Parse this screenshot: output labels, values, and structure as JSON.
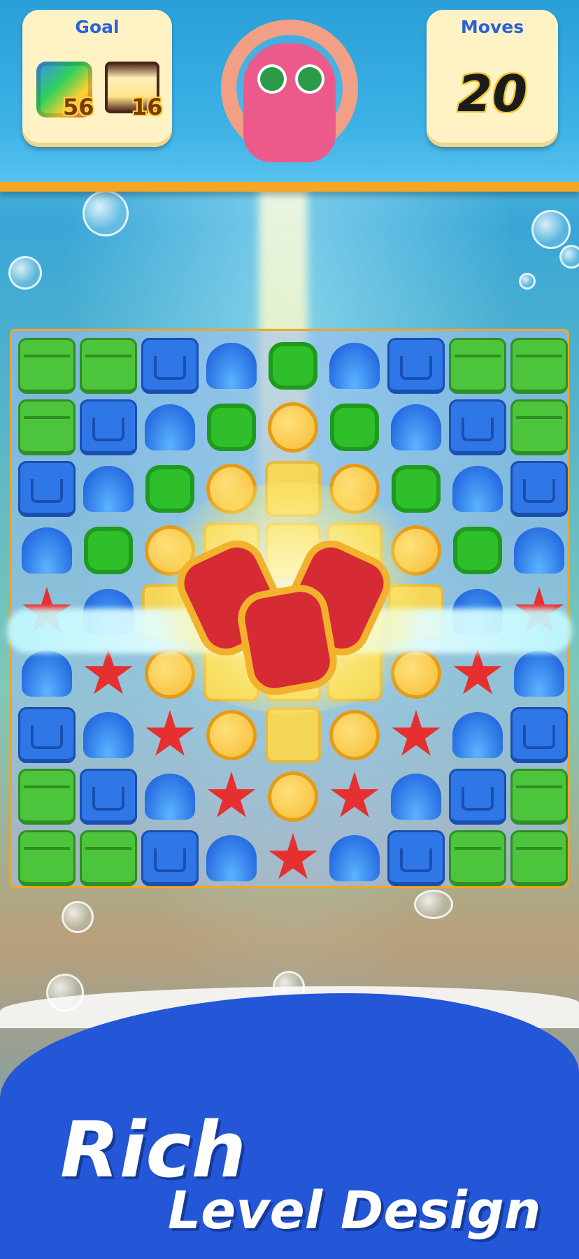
{
  "hud": {
    "goal_title": "Goal",
    "goal_items": [
      {
        "icon": "crown-block-icon",
        "count": "56"
      },
      {
        "icon": "treasure-chest-icon",
        "count": "16"
      }
    ],
    "moves_title": "Moves",
    "moves_value": "20"
  },
  "board": {
    "rows": [
      [
        "crate-g",
        "crate-g",
        "crate-b",
        "shell",
        "turtle",
        "shell",
        "crate-b",
        "crate-g",
        "crate-g"
      ],
      [
        "crate-g",
        "crate-b",
        "shell",
        "turtle",
        "snail",
        "turtle",
        "shell",
        "crate-b",
        "crate-g"
      ],
      [
        "crate-b",
        "shell",
        "turtle",
        "snail",
        "gold",
        "snail",
        "turtle",
        "shell",
        "crate-b"
      ],
      [
        "shell",
        "turtle",
        "snail",
        "gold",
        "gold",
        "gold",
        "snail",
        "turtle",
        "shell"
      ],
      [
        "star",
        "shell",
        "gold",
        "gold",
        "gold",
        "gold",
        "gold",
        "shell",
        "star"
      ],
      [
        "shell",
        "star",
        "snail",
        "gold",
        "gold",
        "gold",
        "snail",
        "star",
        "shell"
      ],
      [
        "crate-b",
        "shell",
        "star",
        "snail",
        "gold",
        "snail",
        "star",
        "shell",
        "crate-b"
      ],
      [
        "crate-g",
        "crate-b",
        "shell",
        "star",
        "snail",
        "star",
        "shell",
        "crate-b",
        "crate-g"
      ],
      [
        "crate-g",
        "crate-g",
        "crate-b",
        "shell",
        "star",
        "shell",
        "crate-b",
        "crate-g",
        "crate-g"
      ]
    ]
  },
  "caption": {
    "line1": "Rich",
    "line2": "Level Design"
  }
}
